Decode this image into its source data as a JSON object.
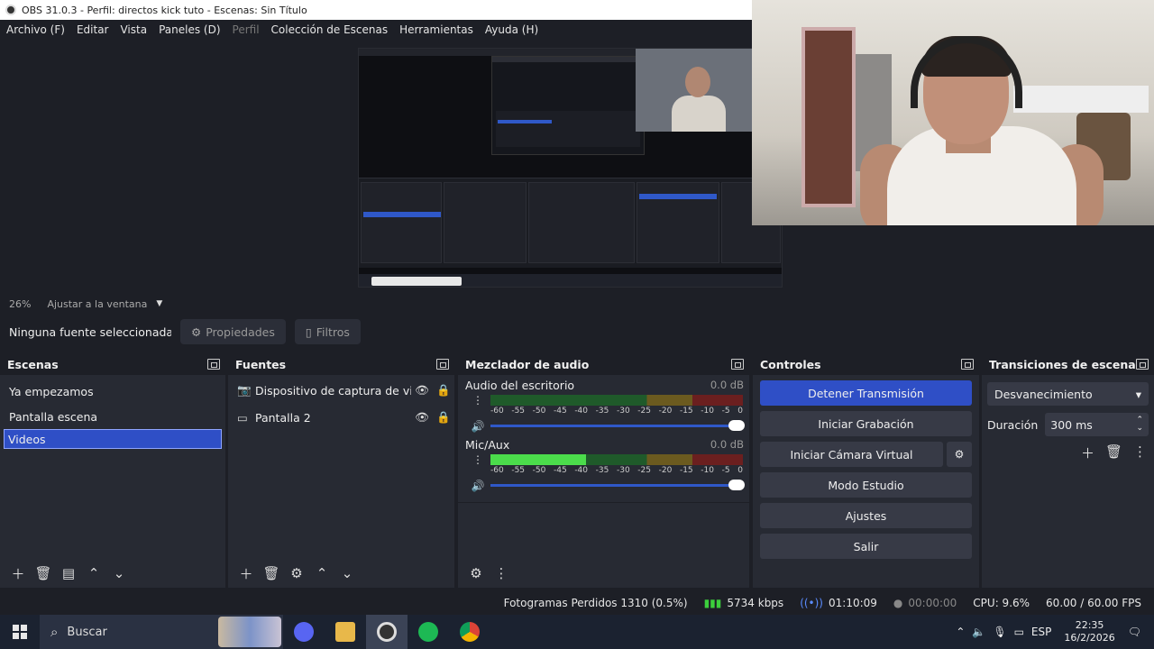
{
  "window": {
    "title": "OBS 31.0.3 - Perfil: directos kick tuto - Escenas: Sin Título"
  },
  "menu": [
    {
      "label": "Archivo (F)",
      "enabled": true
    },
    {
      "label": "Editar",
      "enabled": true
    },
    {
      "label": "Vista",
      "enabled": true
    },
    {
      "label": "Paneles (D)",
      "enabled": true
    },
    {
      "label": "Perfil",
      "enabled": false
    },
    {
      "label": "Colección de Escenas",
      "enabled": true
    },
    {
      "label": "Herramientas",
      "enabled": true
    },
    {
      "label": "Ayuda (H)",
      "enabled": true
    }
  ],
  "preview": {
    "zoom": "26%",
    "fit_label": "Ajustar a la ventana"
  },
  "source_bar": {
    "no_source": "Ninguna fuente seleccionada",
    "properties": "Propiedades",
    "filters": "Filtros"
  },
  "scenes": {
    "title": "Escenas",
    "items": [
      "Ya empezamos",
      "Pantalla escena",
      "Videos"
    ],
    "selected_index": 2
  },
  "sources": {
    "title": "Fuentes",
    "items": [
      {
        "name": "Dispositivo de captura de video",
        "icon": "camera-icon"
      },
      {
        "name": "Pantalla 2",
        "icon": "monitor-icon"
      }
    ]
  },
  "mixer": {
    "title": "Mezclador de audio",
    "channels": [
      {
        "name": "Audio del escritorio",
        "db": "0.0 dB",
        "level": 0.0
      },
      {
        "name": "Mic/Aux",
        "db": "0.0 dB",
        "level": 0.38
      }
    ],
    "scale": [
      "-60",
      "-55",
      "-50",
      "-45",
      "-40",
      "-35",
      "-30",
      "-25",
      "-20",
      "-15",
      "-10",
      "-5",
      "0"
    ]
  },
  "controls": {
    "title": "Controles",
    "stop_stream": "Detener Transmisión",
    "start_recording": "Iniciar Grabación",
    "start_virtual_cam": "Iniciar Cámara Virtual",
    "studio_mode": "Modo Estudio",
    "settings": "Ajustes",
    "exit": "Salir"
  },
  "transitions": {
    "title": "Transiciones de escena",
    "selected": "Desvanecimiento",
    "duration_label": "Duración",
    "duration_value": "300 ms"
  },
  "status": {
    "dropped_frames": "Fotogramas Perdidos 1310 (0.5%)",
    "bitrate": "5734 kbps",
    "stream_time": "01:10:09",
    "rec_time": "00:00:00",
    "cpu": "CPU: 9.6%",
    "fps": "60.00 / 60.00 FPS"
  },
  "taskbar": {
    "search_placeholder": "Buscar",
    "lang": "ESP",
    "time": "22:35",
    "date": "16/2/2026"
  },
  "colors": {
    "accent": "#2f4fc6",
    "panel": "#272a33",
    "bg": "#1d1f26"
  }
}
